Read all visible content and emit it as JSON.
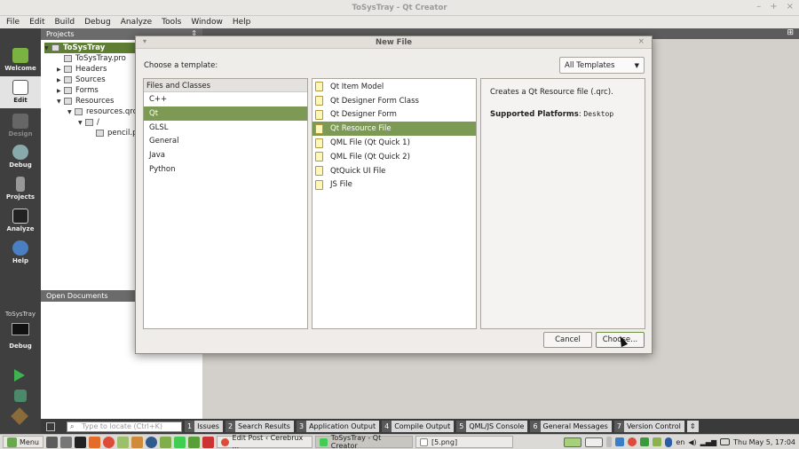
{
  "window": {
    "title": "ToSysTray - Qt Creator",
    "controls": {
      "minimize": "–",
      "maximize": "+",
      "close": "×"
    }
  },
  "menu": [
    "File",
    "Edit",
    "Build",
    "Debug",
    "Analyze",
    "Tools",
    "Window",
    "Help"
  ],
  "modes": [
    {
      "label": "Welcome",
      "icon": "qt-logo-icon"
    },
    {
      "label": "Edit",
      "icon": "document-icon"
    },
    {
      "label": "Design",
      "icon": "design-icon"
    },
    {
      "label": "Debug",
      "icon": "bug-icon"
    },
    {
      "label": "Projects",
      "icon": "wrench-icon"
    },
    {
      "label": "Analyze",
      "icon": "monitor-icon"
    },
    {
      "label": "Help",
      "icon": "help-icon"
    }
  ],
  "kit": {
    "project": "ToSysTray",
    "mode": "Debug"
  },
  "projects": {
    "header": "Projects",
    "tree": [
      "ToSysTray",
      "ToSysTray.pro",
      "Headers",
      "Sources",
      "Forms",
      "Resources",
      "resources.qrc",
      "/",
      "pencil.p"
    ]
  },
  "open_documents": {
    "header": "Open Documents"
  },
  "dialog": {
    "title": "New File",
    "choose_label": "Choose a template:",
    "filter": "All Templates",
    "categories_header": "Files and Classes",
    "categories": [
      "C++",
      "Qt",
      "GLSL",
      "General",
      "Java",
      "Python"
    ],
    "selected_category": 1,
    "templates": [
      "Qt Item Model",
      "Qt Designer Form Class",
      "Qt Designer Form",
      "Qt Resource File",
      "QML File (Qt Quick 1)",
      "QML File (Qt Quick 2)",
      "QtQuick UI File",
      "JS File"
    ],
    "selected_template": 3,
    "description": "Creates a Qt Resource file (.qrc).",
    "platforms_label": "Supported Platforms",
    "platforms_value": "Desktop",
    "cancel_label": "Cancel",
    "choose_label_btn": "Choose..."
  },
  "locator": {
    "placeholder": "Type to locate (Ctrl+K)"
  },
  "output_tabs": [
    {
      "num": "1",
      "label": "Issues"
    },
    {
      "num": "2",
      "label": "Search Results"
    },
    {
      "num": "3",
      "label": "Application Output"
    },
    {
      "num": "4",
      "label": "Compile Output"
    },
    {
      "num": "5",
      "label": "QML/JS Console"
    },
    {
      "num": "6",
      "label": "General Messages"
    },
    {
      "num": "7",
      "label": "Version Control"
    }
  ],
  "taskbar": {
    "menu_label": "Menu",
    "tasks": [
      "Edit Post ‹ Cerebrux ...",
      "ToSysTray - Qt Creator",
      "[5.png]"
    ],
    "keyboard": "en",
    "clock": "Thu May 5, 17:04"
  },
  "colors": {
    "selection": "#7d9a54",
    "modebar": "#3f3f3f"
  }
}
